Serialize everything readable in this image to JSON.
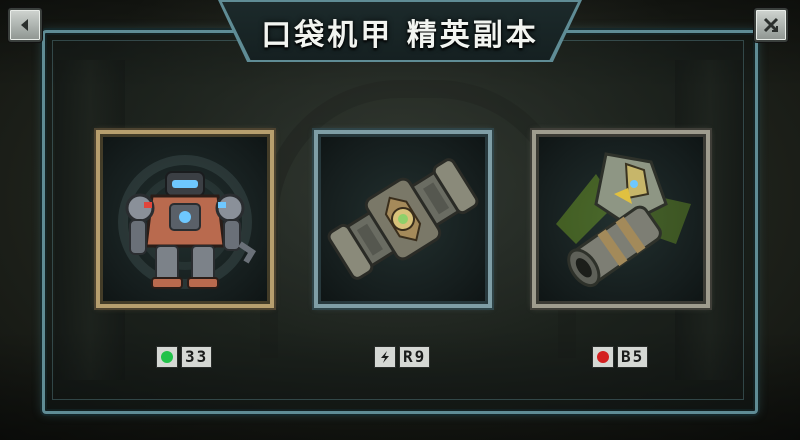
{
  "title": "口袋机甲 精英副本",
  "buttons": {
    "back_icon": "back-arrow-icon",
    "close_icon": "close-x-icon"
  },
  "cards": [
    {
      "item": "mech-robot",
      "frame_color": "#b79f6e",
      "status_icon": "green-dot-icon",
      "status_color": "#22c24a",
      "code": "33"
    },
    {
      "item": "mech-part-cylinder",
      "frame_color": "#7f9ea6",
      "status_icon": "lightning-icon",
      "status_color": "#1a1c1b",
      "code": "R9"
    },
    {
      "item": "mech-arm-cannon",
      "frame_color": "#9f9c8e",
      "status_icon": "red-dot-icon",
      "status_color": "#d42020",
      "code": "B5"
    }
  ]
}
